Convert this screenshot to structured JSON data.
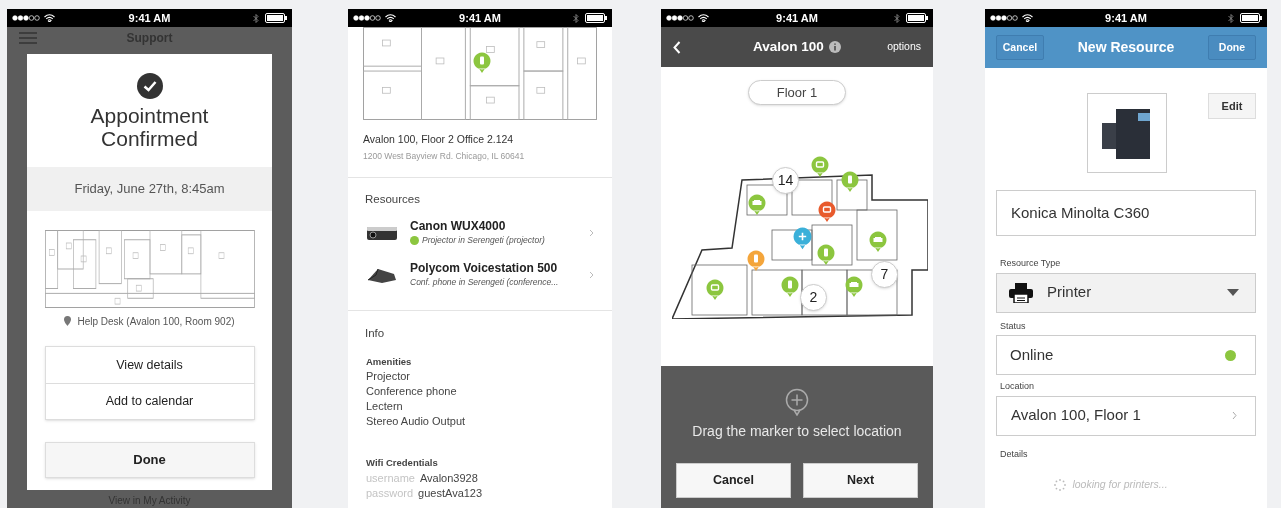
{
  "screens": [
    {
      "kind": "appointment",
      "time": "9:41 AM",
      "header_title": "Support",
      "title": "Appointment Confirmed",
      "datetime": "Friday, June 27th, 8:45am",
      "location": "Help Desk (Avalon 100, Room 902)",
      "actions": [
        "View details",
        "Add to calendar"
      ],
      "primary": "Done",
      "footer_link": "View in My Activity"
    },
    {
      "kind": "location_detail",
      "time": "9:41 AM",
      "address_line": "Avalon 100, Floor 2  Office 2.124",
      "address_sub": "1200 West Bayview Rd. Chicago, IL 60641",
      "resources_heading": "Resources",
      "resources": [
        {
          "kind": "projector",
          "name": "Canon WUX4000",
          "description": "Projector in Serengeti (projector)",
          "online": true
        },
        {
          "kind": "phone",
          "name": "Polycom Voicestation 500",
          "description": "Conf. phone in Serengeti (conference...",
          "online": false
        }
      ],
      "info_heading": "Info",
      "amenities_heading": "Amenities",
      "amenities": [
        "Projector",
        "Conference phone",
        "Lectern",
        "Stereo Audio Output"
      ],
      "wifi_heading": "Wifi Credentials",
      "credentials": [
        {
          "label": "username",
          "value": "Avalon3928"
        },
        {
          "label": "password",
          "value": "guestAva123"
        }
      ]
    },
    {
      "kind": "map_picker",
      "time": "9:41 AM",
      "title": "Avalon 100",
      "right_action": "options",
      "floor": "Floor 1",
      "clusters": [
        "14",
        "7",
        "2"
      ],
      "markers": [
        {
          "kind": "display",
          "color": "#8cc63f"
        },
        {
          "kind": "door",
          "color": "#8cc63f"
        },
        {
          "kind": "printer",
          "color": "#8cc63f"
        },
        {
          "kind": "display",
          "color": "#e85a2c"
        },
        {
          "kind": "printer",
          "color": "#8cc63f"
        },
        {
          "kind": "door",
          "color": "#f4a53b"
        },
        {
          "kind": "door",
          "color": "#8cc63f"
        },
        {
          "kind": "display",
          "color": "#8cc63f"
        },
        {
          "kind": "door",
          "color": "#8cc63f"
        },
        {
          "kind": "printer",
          "color": "#8cc63f"
        }
      ],
      "hint": "Drag the marker to select location",
      "buttons": [
        "Cancel",
        "Next"
      ]
    },
    {
      "kind": "new_resource",
      "time": "9:41 AM",
      "cancel": "Cancel",
      "title": "New Resource",
      "done": "Done",
      "edit": "Edit",
      "name_value": "Konica Minolta C360",
      "type_label": "Resource Type",
      "type_value": "Printer",
      "status_label": "Status",
      "status_value": "Online",
      "status_dot": {
        "color": "#8cc63f"
      },
      "location_label": "Location",
      "location_value": "Avalon 100, Floor 1",
      "details_label": "Details",
      "loading": "looking for printers..."
    }
  ]
}
